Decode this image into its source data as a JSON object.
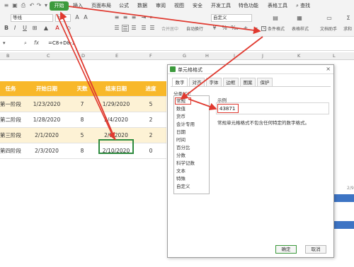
{
  "quick_access": {
    "icons": [
      "menu-icon",
      "save-icon",
      "print-icon",
      "undo-icon",
      "redo-icon",
      "more-icon"
    ]
  },
  "menu": {
    "start_tab": "开始",
    "tabs": [
      "插入",
      "页面布局",
      "公式",
      "数据",
      "审阅",
      "视图",
      "安全",
      "开发工具",
      "特色功能",
      "表格工具"
    ],
    "search_label": "查找"
  },
  "toolbar": {
    "font_name": "等线",
    "font_size": "11",
    "format_combo": "自定义",
    "merge_label": "合并居中",
    "wrap_label": "自动换行",
    "conditional_label": "条件格式",
    "table_style_label": "表格样式",
    "doc_assistant_label": "文档助手",
    "sum_label": "求和"
  },
  "formula_bar": {
    "fx_label": "fx",
    "formula": "=C8+D8-1"
  },
  "columns": [
    "B",
    "C",
    "D",
    "E",
    "F",
    "G",
    "H",
    "I",
    "J",
    "K",
    "L"
  ],
  "table": {
    "headers": [
      "任务",
      "开始日期",
      "天数",
      "结束日期",
      "进度"
    ],
    "rows": [
      [
        "第一阶段",
        "1/23/2020",
        "7",
        "1/29/2020",
        "5"
      ],
      [
        "第二阶段",
        "1/28/2020",
        "8",
        "2/4/2020",
        "2"
      ],
      [
        "第三阶段",
        "2/1/2020",
        "5",
        "2/5/2020",
        "2"
      ],
      [
        "第四阶段",
        "2/3/2020",
        "8",
        "2/10/2020",
        "0"
      ]
    ]
  },
  "right_hint": "2/9",
  "dialog": {
    "title": "单元格格式",
    "close": "×",
    "tabs": [
      "数字",
      "对齐",
      "字体",
      "边框",
      "图案",
      "保护"
    ],
    "category_label": "分类(C):",
    "categories": [
      "常规",
      "数值",
      "货币",
      "会计专用",
      "日期",
      "时间",
      "百分比",
      "分数",
      "科学记数",
      "文本",
      "特殊",
      "自定义"
    ],
    "sample_label": "示例",
    "sample_value": "43871",
    "description": "常规单元格格式不包含任何特定的数字格式。",
    "ok_label": "确定",
    "cancel_label": "取消"
  },
  "colors": {
    "accent_green": "#3c9a3c",
    "header_orange": "#f8b82a",
    "band": "#fdf2d5",
    "annotation_red": "#e0392f",
    "chart_blue": "#3d74c4"
  }
}
